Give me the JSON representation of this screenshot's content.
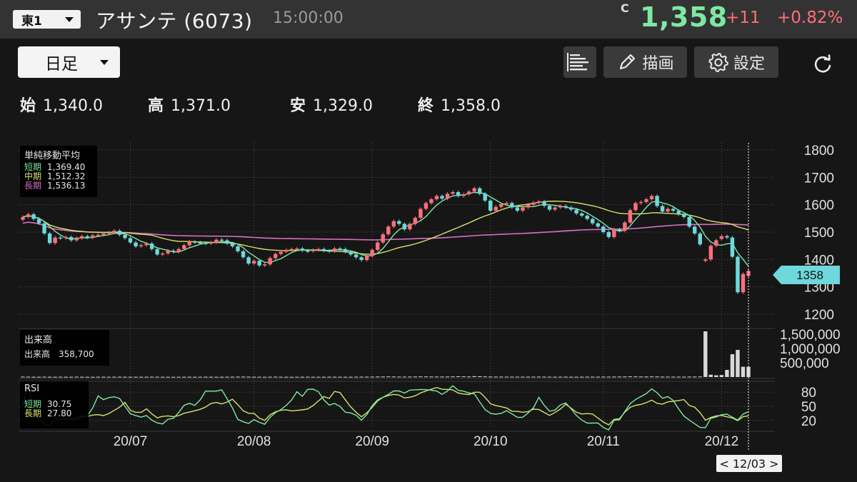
{
  "header": {
    "market": "東1",
    "stock_name": "アサンテ (6073)",
    "time": "15:00:00",
    "price_flag": "C",
    "price": "1,358",
    "change": "+11",
    "change_pct": "+0.82%"
  },
  "toolbar": {
    "period": "日足",
    "draw_label": "描画",
    "settings_label": "設定"
  },
  "ohlc": [
    {
      "key": "始",
      "value": "1,340.0"
    },
    {
      "key": "高",
      "value": "1,371.0"
    },
    {
      "key": "安",
      "value": "1,329.0"
    },
    {
      "key": "終",
      "value": "1,358.0"
    }
  ],
  "legends": {
    "ma": {
      "title": "単純移動平均",
      "short_label": "短期",
      "short_value": "1,369.40",
      "mid_label": "中期",
      "mid_value": "1,512.32",
      "long_label": "長期",
      "long_value": "1,536.13"
    },
    "volume": {
      "title": "出来高",
      "label": "出来高",
      "value": "358,700"
    },
    "rsi": {
      "title": "RSI",
      "short_label": "短期",
      "short_value": "30.75",
      "long_label": "長期",
      "long_value": "27.80"
    }
  },
  "cursor_date": "< 12/03 >",
  "price_tag": "1358",
  "colors": {
    "up": "#ff6f7c",
    "down": "#6fd8dc",
    "ma_short": "#7ee8a3",
    "ma_mid": "#d9e26a",
    "ma_long": "#d86fc4",
    "rsi_short": "#7ee8a3",
    "rsi_long": "#d9e26a"
  },
  "chart_data": {
    "type": "candlestick",
    "price_axis": {
      "min": 1200,
      "max": 1800,
      "ticks": [
        "1800",
        "1700",
        "1600",
        "1500",
        "1400",
        "1300",
        "1200"
      ]
    },
    "volume_axis": {
      "ticks": [
        "1,500,000",
        "1,000,000",
        "500,000"
      ]
    },
    "rsi_axis": {
      "ticks": [
        "80",
        "50",
        "20"
      ]
    },
    "x_ticks": [
      {
        "label": "20/07",
        "index": 20
      },
      {
        "label": "20/08",
        "index": 43
      },
      {
        "label": "20/09",
        "index": 65
      },
      {
        "label": "20/10",
        "index": 87
      },
      {
        "label": "20/11",
        "index": 108
      },
      {
        "label": "20/12",
        "index": 130
      }
    ],
    "close": [
      1555,
      1565,
      1548,
      1532,
      1495,
      1460,
      1480,
      1478,
      1482,
      1470,
      1478,
      1485,
      1480,
      1488,
      1490,
      1495,
      1498,
      1505,
      1490,
      1478,
      1462,
      1448,
      1452,
      1458,
      1438,
      1418,
      1422,
      1432,
      1428,
      1438,
      1452,
      1465,
      1462,
      1460,
      1458,
      1462,
      1472,
      1470,
      1458,
      1448,
      1430,
      1408,
      1385,
      1395,
      1378,
      1382,
      1405,
      1420,
      1428,
      1435,
      1438,
      1440,
      1432,
      1430,
      1435,
      1438,
      1432,
      1430,
      1440,
      1438,
      1428,
      1418,
      1408,
      1398,
      1412,
      1435,
      1462,
      1492,
      1520,
      1540,
      1530,
      1510,
      1530,
      1552,
      1585,
      1606,
      1620,
      1632,
      1622,
      1640,
      1646,
      1632,
      1638,
      1648,
      1660,
      1640,
      1615,
      1578,
      1592,
      1602,
      1606,
      1590,
      1578,
      1590,
      1600,
      1608,
      1612,
      1596,
      1582,
      1590,
      1595,
      1590,
      1582,
      1568,
      1560,
      1548,
      1532,
      1520,
      1500,
      1482,
      1510,
      1505,
      1535,
      1580,
      1606,
      1610,
      1620,
      1632,
      1595,
      1575,
      1585,
      1578,
      1565,
      1555,
      1520,
      1495,
      1455,
      1400,
      1450,
      1470,
      1485,
      1480,
      1410,
      1280,
      1347,
      1358
    ],
    "open": [
      1545,
      1555,
      1565,
      1548,
      1532,
      1495,
      1460,
      1480,
      1478,
      1482,
      1470,
      1478,
      1485,
      1480,
      1488,
      1490,
      1495,
      1498,
      1505,
      1490,
      1478,
      1462,
      1448,
      1452,
      1458,
      1438,
      1418,
      1422,
      1432,
      1428,
      1438,
      1452,
      1465,
      1462,
      1460,
      1458,
      1462,
      1472,
      1470,
      1458,
      1448,
      1430,
      1408,
      1385,
      1395,
      1378,
      1382,
      1405,
      1420,
      1428,
      1435,
      1438,
      1440,
      1432,
      1430,
      1435,
      1438,
      1432,
      1430,
      1440,
      1438,
      1428,
      1418,
      1408,
      1398,
      1412,
      1435,
      1462,
      1492,
      1520,
      1540,
      1530,
      1510,
      1530,
      1552,
      1585,
      1606,
      1620,
      1632,
      1622,
      1640,
      1646,
      1632,
      1638,
      1648,
      1660,
      1640,
      1615,
      1578,
      1592,
      1602,
      1606,
      1590,
      1578,
      1590,
      1600,
      1608,
      1612,
      1596,
      1582,
      1590,
      1595,
      1590,
      1582,
      1568,
      1560,
      1548,
      1532,
      1520,
      1500,
      1482,
      1510,
      1505,
      1535,
      1580,
      1606,
      1610,
      1620,
      1632,
      1595,
      1575,
      1585,
      1578,
      1565,
      1555,
      1520,
      1495,
      1395,
      1400,
      1450,
      1475,
      1485,
      1480,
      1410,
      1280,
      1340
    ],
    "volume": [
      15000,
      12000,
      9000,
      8000,
      11000,
      9000,
      8000,
      10000,
      9000,
      8000,
      12000,
      9000,
      8000,
      7000,
      9000,
      10000,
      8000,
      9000,
      11000,
      8000,
      9000,
      10000,
      8000,
      9000,
      12000,
      10000,
      9000,
      8000,
      7000,
      8000,
      9000,
      10000,
      8000,
      9000,
      11000,
      9000,
      8000,
      9000,
      10000,
      11000,
      13000,
      15000,
      12000,
      10000,
      9000,
      8000,
      10000,
      11000,
      9000,
      8000,
      7000,
      8000,
      9000,
      10000,
      8000,
      7000,
      8000,
      9000,
      10000,
      9000,
      8000,
      9000,
      10000,
      12000,
      11000,
      14000,
      16000,
      18000,
      20000,
      17000,
      15000,
      13000,
      15000,
      18000,
      20000,
      19000,
      17000,
      16000,
      15000,
      17000,
      20000,
      24000,
      22000,
      18000,
      30000,
      26000,
      20000,
      16000,
      14000,
      13000,
      12000,
      13000,
      12000,
      11000,
      12000,
      13000,
      14000,
      12000,
      11000,
      10000,
      11000,
      12000,
      10000,
      9000,
      10000,
      11000,
      12000,
      11000,
      14000,
      13000,
      15000,
      16000,
      18000,
      22000,
      20000,
      18000,
      17000,
      20000,
      18000,
      15000,
      14000,
      13000,
      12000,
      11000,
      14000,
      16000,
      18000,
      1600000,
      80000,
      60000,
      70000,
      250000,
      800000,
      950000,
      360000,
      358700
    ]
  }
}
